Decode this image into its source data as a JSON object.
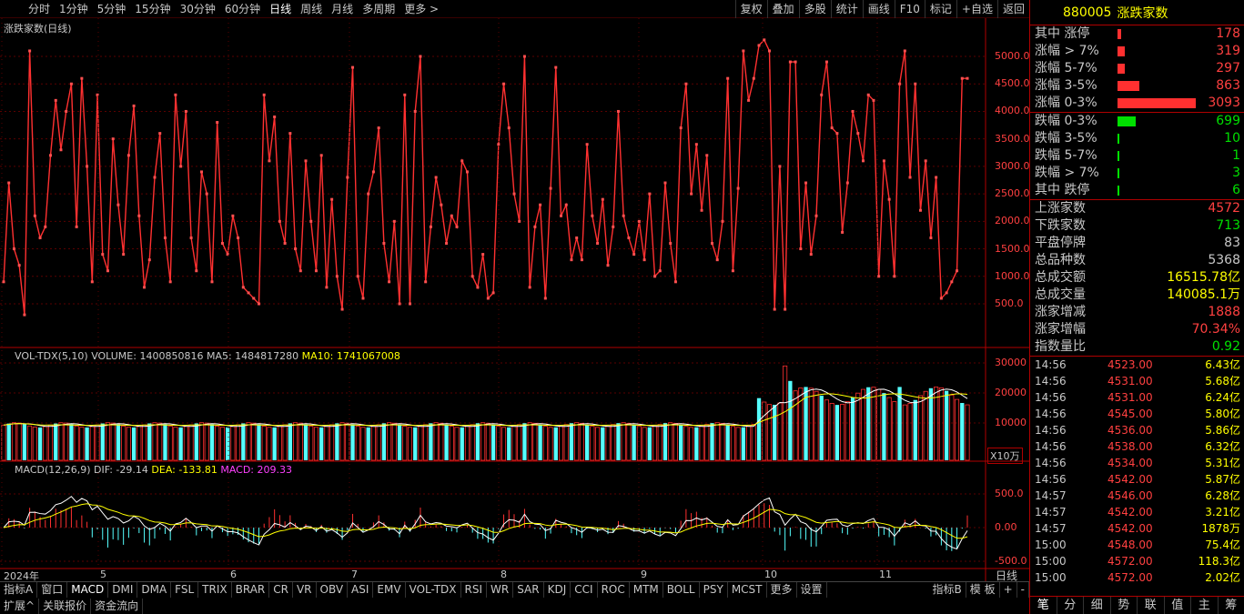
{
  "toolbar": {
    "periods": [
      "分时",
      "1分钟",
      "5分钟",
      "15分钟",
      "30分钟",
      "60分钟",
      "日线",
      "周线",
      "月线",
      "多周期",
      "更多 >"
    ],
    "active_period": "日线",
    "actions": [
      "复权",
      "叠加",
      "多股",
      "统计",
      "画线",
      "F10",
      "标记",
      "+自选",
      "返回"
    ]
  },
  "main_panel": {
    "title": "涨跌家数(日线)",
    "yticks": [
      "5000.0",
      "4500.0",
      "4000.0",
      "3500.0",
      "3000.0",
      "2500.0",
      "2000.0",
      "1500.0",
      "1000.0",
      "500.0"
    ]
  },
  "vol_panel": {
    "label_name": "VOL-TDX(5,10)",
    "label_volume": "VOLUME: 1400850816",
    "label_ma5": "MA5: 1484817280",
    "label_ma10": "MA10: 1741067008",
    "yticks": [
      "30000",
      "20000",
      "10000"
    ],
    "unit": "X10万"
  },
  "macd_panel": {
    "label_name": "MACD(12,26,9)",
    "label_dif": "DIF: -29.14",
    "label_dea": "DEA: -133.81",
    "label_macd": "MACD: 209.33",
    "yticks": [
      "500.0",
      "0.00",
      "-500.0"
    ]
  },
  "dates": [
    "2024年",
    "5",
    "6",
    "7",
    "8",
    "9",
    "10",
    "11"
  ],
  "date_axis_right": "日线",
  "chart_data": {
    "type": "line",
    "title": "涨跌家数(日线)",
    "ylim": [
      0,
      5600
    ],
    "series": [
      {
        "name": "涨跌家数",
        "values": [
          900,
          2700,
          1500,
          1200,
          300,
          5100,
          2100,
          1700,
          1900,
          3200,
          4200,
          3300,
          4000,
          4500,
          1900,
          4600,
          3000,
          900,
          4300,
          1400,
          1100,
          3500,
          2300,
          1400,
          3200,
          4100,
          2100,
          800,
          1300,
          2800,
          3600,
          1700,
          900,
          4300,
          3000,
          4000,
          1700,
          1100,
          2900,
          2500,
          900,
          3800,
          1600,
          1400,
          2100,
          1700,
          800,
          700,
          600,
          500,
          4300,
          3100,
          3900,
          2000,
          1600,
          3600,
          1500,
          1100,
          3100,
          2000,
          1100,
          3200,
          800,
          2400,
          1000,
          400,
          2800,
          4800,
          1000,
          600,
          2500,
          2900,
          3700,
          1600,
          900,
          2000,
          500,
          4300,
          500,
          4000,
          5000,
          900,
          1900,
          2800,
          2300,
          1600,
          2100,
          1900,
          3100,
          2900,
          1000,
          800,
          1400,
          600,
          700,
          3400,
          4500,
          3700,
          2500,
          2000,
          5000,
          800,
          1900,
          2300,
          600,
          2600,
          4800,
          2100,
          2300,
          1300,
          1700,
          1300,
          3400,
          2100,
          1600,
          2400,
          1200,
          1900,
          4000,
          2100,
          1700,
          1400,
          2000,
          1300,
          2500,
          1000,
          1100,
          2700,
          1600,
          900,
          3700,
          4500,
          2500,
          3400,
          2200,
          3200,
          1600,
          1300,
          2000,
          4600,
          1100,
          2600,
          5100,
          4200,
          4600,
          5200,
          5300,
          5100,
          400,
          3000,
          400,
          4900,
          4900,
          1500,
          2700,
          1400,
          2100,
          4300,
          4900,
          3700,
          3600,
          1800,
          2700,
          4000,
          3600,
          3100,
          4300,
          4200,
          1000,
          3100,
          2400,
          1000,
          4500,
          5100,
          2800,
          4500,
          2200,
          3100,
          1700,
          2800,
          600,
          700,
          900,
          1100,
          4600,
          4600
        ]
      }
    ],
    "xlabel": "",
    "ylabel": ""
  },
  "right_panel": {
    "code": "880005",
    "name": "涨跌家数",
    "breadth": [
      {
        "label": "其中 涨停",
        "value": "178",
        "bar": 0.02,
        "color": "#ff3030"
      },
      {
        "label": "涨幅 > 7%",
        "value": "319",
        "bar": 0.04,
        "color": "#ff3030"
      },
      {
        "label": "涨幅 5-7%",
        "value": "297",
        "bar": 0.04,
        "color": "#ff3030"
      },
      {
        "label": "涨幅 3-5%",
        "value": "863",
        "bar": 0.12,
        "color": "#ff3030"
      },
      {
        "label": "涨幅 0-3%",
        "value": "3093",
        "bar": 0.43,
        "color": "#ff3030"
      },
      {
        "label": "跌幅 0-3%",
        "value": "699",
        "bar": 0.1,
        "color": "#00e000"
      },
      {
        "label": "跌幅 3-5%",
        "value": "10",
        "bar": 0.005,
        "color": "#00e000"
      },
      {
        "label": "跌幅 5-7%",
        "value": "1",
        "bar": 0.005,
        "color": "#00e000"
      },
      {
        "label": "跌幅 > 7%",
        "value": "3",
        "bar": 0.005,
        "color": "#00e000"
      },
      {
        "label": "其中 跌停",
        "value": "6",
        "bar": 0.005,
        "color": "#00e000"
      }
    ],
    "stats": [
      {
        "label": "上涨家数",
        "value": "4572",
        "color": "#ff4040"
      },
      {
        "label": "下跌家数",
        "value": "713",
        "color": "#00e000"
      },
      {
        "label": "平盘停牌",
        "value": "83",
        "color": "#c8c8c8"
      },
      {
        "label": "总品种数",
        "value": "5368",
        "color": "#c8c8c8"
      },
      {
        "label": "总成交额",
        "value": "16515.78亿",
        "color": "#ffff00"
      },
      {
        "label": "总成交量",
        "value": "140085.1万",
        "color": "#ffff00"
      },
      {
        "label": "涨家增减",
        "value": "1888",
        "color": "#ff4040"
      },
      {
        "label": "涨家增幅",
        "value": "70.34%",
        "color": "#ff4040"
      },
      {
        "label": "指数量比",
        "value": "0.92",
        "color": "#00e000"
      }
    ],
    "ticks": [
      {
        "t": "14:56",
        "p": "4523.00",
        "a": "6.43亿"
      },
      {
        "t": "14:56",
        "p": "4531.00",
        "a": "5.68亿"
      },
      {
        "t": "14:56",
        "p": "4531.00",
        "a": "6.24亿"
      },
      {
        "t": "14:56",
        "p": "4545.00",
        "a": "5.80亿"
      },
      {
        "t": "14:56",
        "p": "4536.00",
        "a": "5.86亿"
      },
      {
        "t": "14:56",
        "p": "4538.00",
        "a": "6.32亿"
      },
      {
        "t": "14:56",
        "p": "4534.00",
        "a": "5.31亿"
      },
      {
        "t": "14:56",
        "p": "4542.00",
        "a": "5.87亿"
      },
      {
        "t": "14:57",
        "p": "4546.00",
        "a": "6.28亿"
      },
      {
        "t": "14:57",
        "p": "4542.00",
        "a": "3.21亿"
      },
      {
        "t": "14:57",
        "p": "4542.00",
        "a": "1878万"
      },
      {
        "t": "15:00",
        "p": "4548.00",
        "a": "75.4亿"
      },
      {
        "t": "15:00",
        "p": "4572.00",
        "a": "118.3亿"
      },
      {
        "t": "15:00",
        "p": "4572.00",
        "a": "2.02亿"
      }
    ],
    "bottom_tabs": [
      "笔",
      "分",
      "细",
      "势",
      "联",
      "值",
      "主",
      "筹"
    ]
  },
  "indicator_tabs": [
    "指标A",
    "窗口",
    "MACD",
    "DMI",
    "DMA",
    "FSL",
    "TRIX",
    "BRAR",
    "CR",
    "VR",
    "OBV",
    "ASI",
    "EMV",
    "VOL-TDX",
    "RSI",
    "WR",
    "SAR",
    "KDJ",
    "CCI",
    "ROC",
    "MTM",
    "BOLL",
    "PSY",
    "MCST",
    "更多",
    "设置"
  ],
  "indicator_tabs_right": [
    "指标B",
    "模 板",
    "+",
    "-"
  ],
  "bottom_bar": [
    "扩展^",
    "关联报价",
    "资金流向"
  ]
}
